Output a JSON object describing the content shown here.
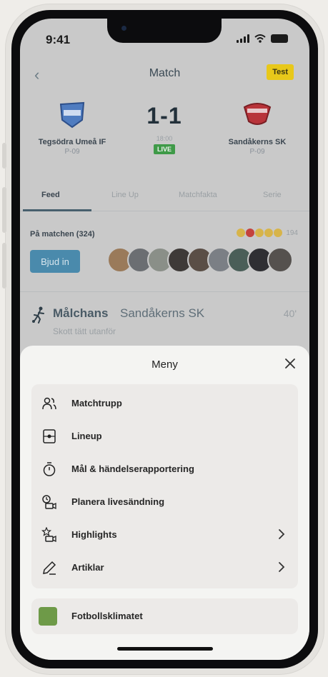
{
  "status_bar": {
    "time": "9:41"
  },
  "nav": {
    "title": "Match",
    "badge": "Test"
  },
  "match": {
    "home": {
      "name": "Tegsödra Umeå IF",
      "class": "P-09"
    },
    "away": {
      "name": "Sandåkerns SK",
      "class": "P-09"
    },
    "score": "1-1",
    "kickoff": "18:00",
    "status": "LIVE"
  },
  "tabs": [
    {
      "label": "Feed",
      "active": true
    },
    {
      "label": "Line Up",
      "active": false
    },
    {
      "label": "Matchfakta",
      "active": false
    },
    {
      "label": "Serie",
      "active": false
    }
  ],
  "attendance": {
    "label": "På matchen (324)",
    "reaction_count": "194",
    "invite_label": "Bjud in"
  },
  "feed_event": {
    "type": "Målchans",
    "team": "Sandåkerns SK",
    "minute": "40'",
    "description": "Skott tätt utanför"
  },
  "menu": {
    "title": "Meny",
    "items": [
      {
        "label": "Matchtrupp",
        "icon": "people-icon",
        "chevron": false
      },
      {
        "label": "Lineup",
        "icon": "lineup-icon",
        "chevron": false
      },
      {
        "label": "Mål & händelserapportering",
        "icon": "stopwatch-icon",
        "chevron": false
      },
      {
        "label": "Planera livesändning",
        "icon": "schedule-video-icon",
        "chevron": false
      },
      {
        "label": "Highlights",
        "icon": "star-video-icon",
        "chevron": true
      },
      {
        "label": "Artiklar",
        "icon": "pen-icon",
        "chevron": true
      }
    ],
    "extra": {
      "label": "Fotbollsklimatet",
      "icon": "fotbollsklimatet-logo"
    }
  },
  "colors": {
    "live": "#3f9a48",
    "test_badge": "#e8c81a",
    "invite_button": "#4a8aac",
    "sheet_background": "#f4f4f2"
  }
}
